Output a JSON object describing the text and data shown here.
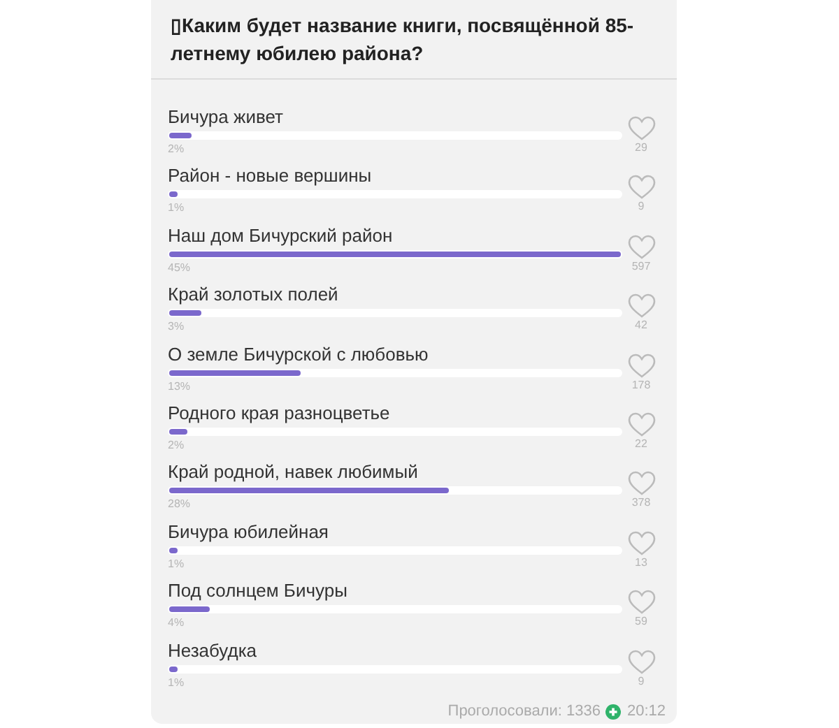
{
  "poll": {
    "question": "▯Каким будет название книги, посвящённой 85-летнему юбилею района?",
    "options": [
      {
        "label": "Бичура живет",
        "percent": "2%",
        "votes": "29",
        "level": 0.05
      },
      {
        "label": "Район - новые вершины",
        "percent": "1%",
        "votes": "9",
        "level": 0.02
      },
      {
        "label": "Наш дом Бичурский район",
        "percent": "45%",
        "votes": "597",
        "level": 1.0
      },
      {
        "label": "Край золотых полей",
        "percent": "3%",
        "votes": "42",
        "level": 0.07
      },
      {
        "label": "О земле Бичурской с любовью",
        "percent": "13%",
        "votes": "178",
        "level": 0.29
      },
      {
        "label": "Родного края разноцветье",
        "percent": "2%",
        "votes": "22",
        "level": 0.04
      },
      {
        "label": "Край родной, навек любимый",
        "percent": "28%",
        "votes": "378",
        "level": 0.62
      },
      {
        "label": "Бичура юбилейная",
        "percent": "1%",
        "votes": "13",
        "level": 0.02
      },
      {
        "label": "Под солнцем Бичуры",
        "percent": "4%",
        "votes": "59",
        "level": 0.09
      },
      {
        "label": "Незабудка",
        "percent": "1%",
        "votes": "9",
        "level": 0.02
      }
    ],
    "total": "Проголосовали: 1336",
    "time": "20:12"
  }
}
